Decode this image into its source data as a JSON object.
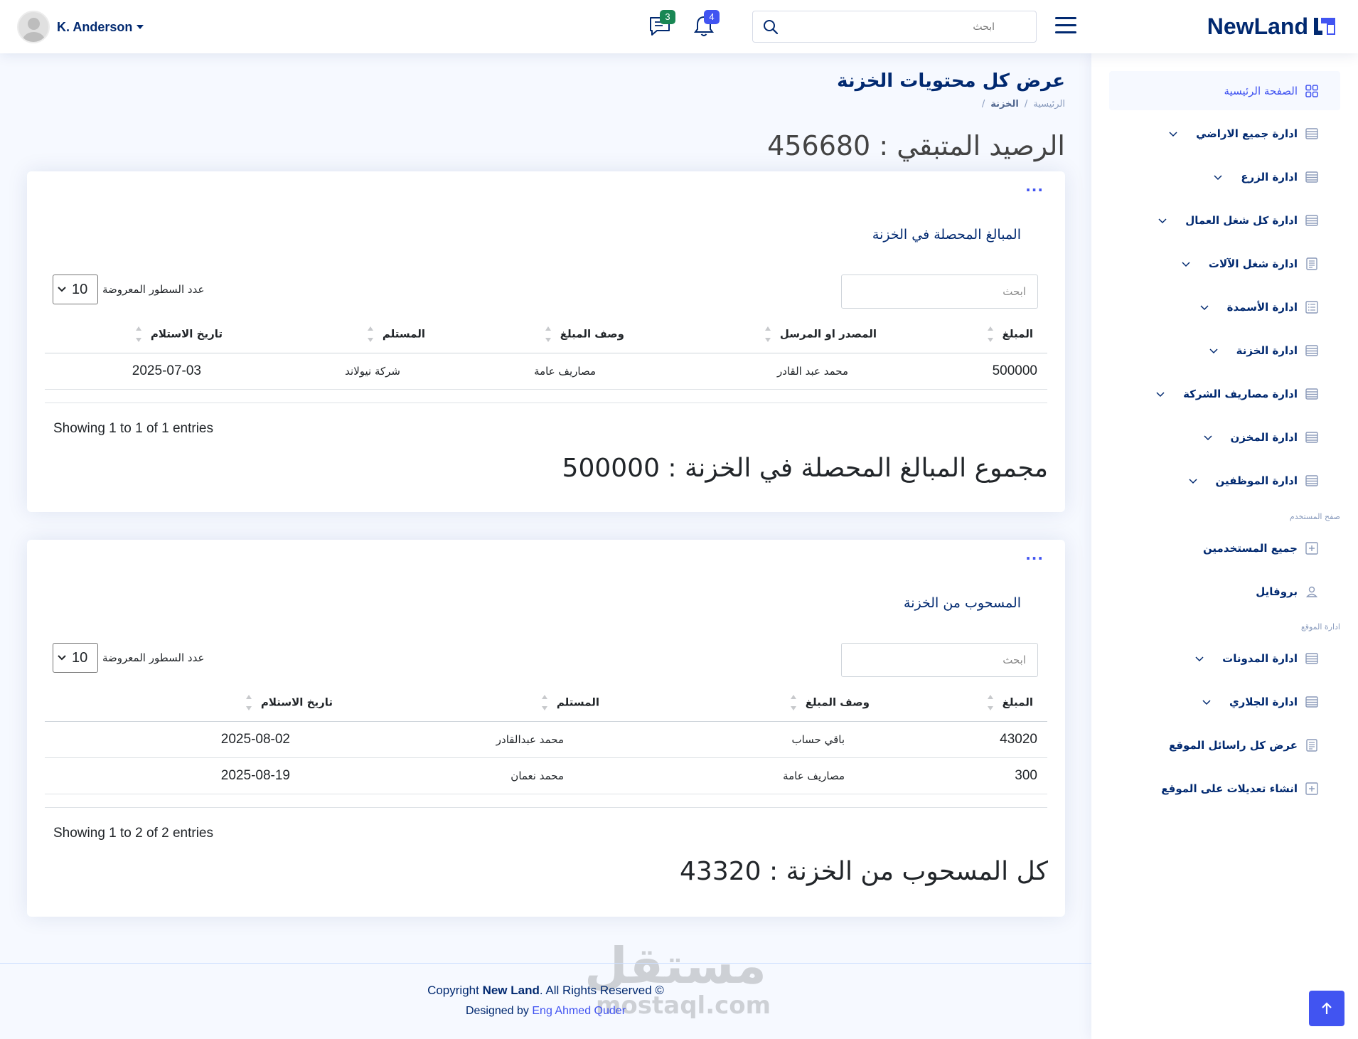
{
  "header": {
    "logo_text": "NewLand",
    "search_placeholder": "ابحث",
    "notifications_count": "4",
    "messages_count": "3",
    "user_name": "K. Anderson",
    "colors": {
      "accent": "#4154f1",
      "brand": "#012970",
      "success": "#198754"
    }
  },
  "sidebar": {
    "home": "الصفحة الرئيسية",
    "items": [
      {
        "label": "ادارة جميع الاراضي",
        "icon": "layout-icon"
      },
      {
        "label": "ادارة الزرع",
        "icon": "layout-icon"
      },
      {
        "label": "ادارة كل شغل العمال",
        "icon": "layout-icon"
      },
      {
        "label": "ادارة شغل الآلات",
        "icon": "document-icon"
      },
      {
        "label": "ادارة الأسمدة",
        "icon": "list-icon"
      },
      {
        "label": "ادارة الخزنة",
        "icon": "layout-icon"
      },
      {
        "label": "ادارة مصاريف الشركة",
        "icon": "layout-icon"
      },
      {
        "label": "ادارة المخزن",
        "icon": "layout-icon"
      },
      {
        "label": "ادارة الموظفين",
        "icon": "layout-icon"
      }
    ],
    "heading_user": "صفح المستخدم",
    "user_items": [
      {
        "label": "جميع المستخدمين",
        "icon": "plus-square-icon"
      },
      {
        "label": "بروفايل",
        "icon": "person-icon"
      }
    ],
    "heading_site": "ادارة الموقع",
    "site_items": [
      {
        "label": "ادارة المدونات",
        "icon": "layout-icon"
      },
      {
        "label": "ادارة الجلاري",
        "icon": "layout-icon"
      },
      {
        "label": "عرض كل راسائل الموقع",
        "icon": "document-icon"
      },
      {
        "label": "انشاء تعديلات على الموقع",
        "icon": "plus-square-icon"
      }
    ]
  },
  "page": {
    "title": "عرض كل محتويات الخزنة",
    "breadcrumb": [
      "الرئيسية",
      "/",
      "الخزنة",
      "/"
    ],
    "balance": "الرصيد المتبقي : 456680"
  },
  "income": {
    "title": "المبالغ المحصلة في الخزنة",
    "search_placeholder": "ابحث",
    "length_value": "10",
    "length_label": "عدد السطور المعروضة",
    "columns": [
      "المبلغ",
      "المصدر او المرسل",
      "وصف المبلغ",
      "المستلم",
      "تاريخ الاستلام"
    ],
    "rows": [
      [
        "500000",
        "محمد عبد القادر",
        "مصاريف عامة",
        "شركة نيولاند",
        "2025-07-03"
      ]
    ],
    "info": "Showing 1 to 1 of 1 entries",
    "total": "مجموع المبالغ المحصلة في الخزنة : 500000"
  },
  "withdrawn": {
    "title": "المسحوب من الخزنة",
    "search_placeholder": "ابحث",
    "length_value": "10",
    "length_label": "عدد السطور المعروضة",
    "columns": [
      "المبلغ",
      "وصف المبلغ",
      "المستلم",
      "تاريخ الاستلام"
    ],
    "rows": [
      [
        "43020",
        "باقي حساب",
        "محمد عبدالقادر",
        "2025-08-02"
      ],
      [
        "300",
        "مصاريف عامة",
        "محمد نعمان",
        "2025-08-19"
      ]
    ],
    "info": "Showing 1 to 2 of 2 entries",
    "total": "كل المسحوب من الخزنة : 43320"
  },
  "footer": {
    "copyright_prefix": "Copyright",
    "brand": "New Land",
    "copyright_suffix": ". All Rights Reserved ©",
    "designed_by": "Designed by",
    "designer": "Eng Ahmed Quder"
  },
  "watermark": {
    "arabic": "مستقل",
    "latin": "mostaql.com"
  }
}
